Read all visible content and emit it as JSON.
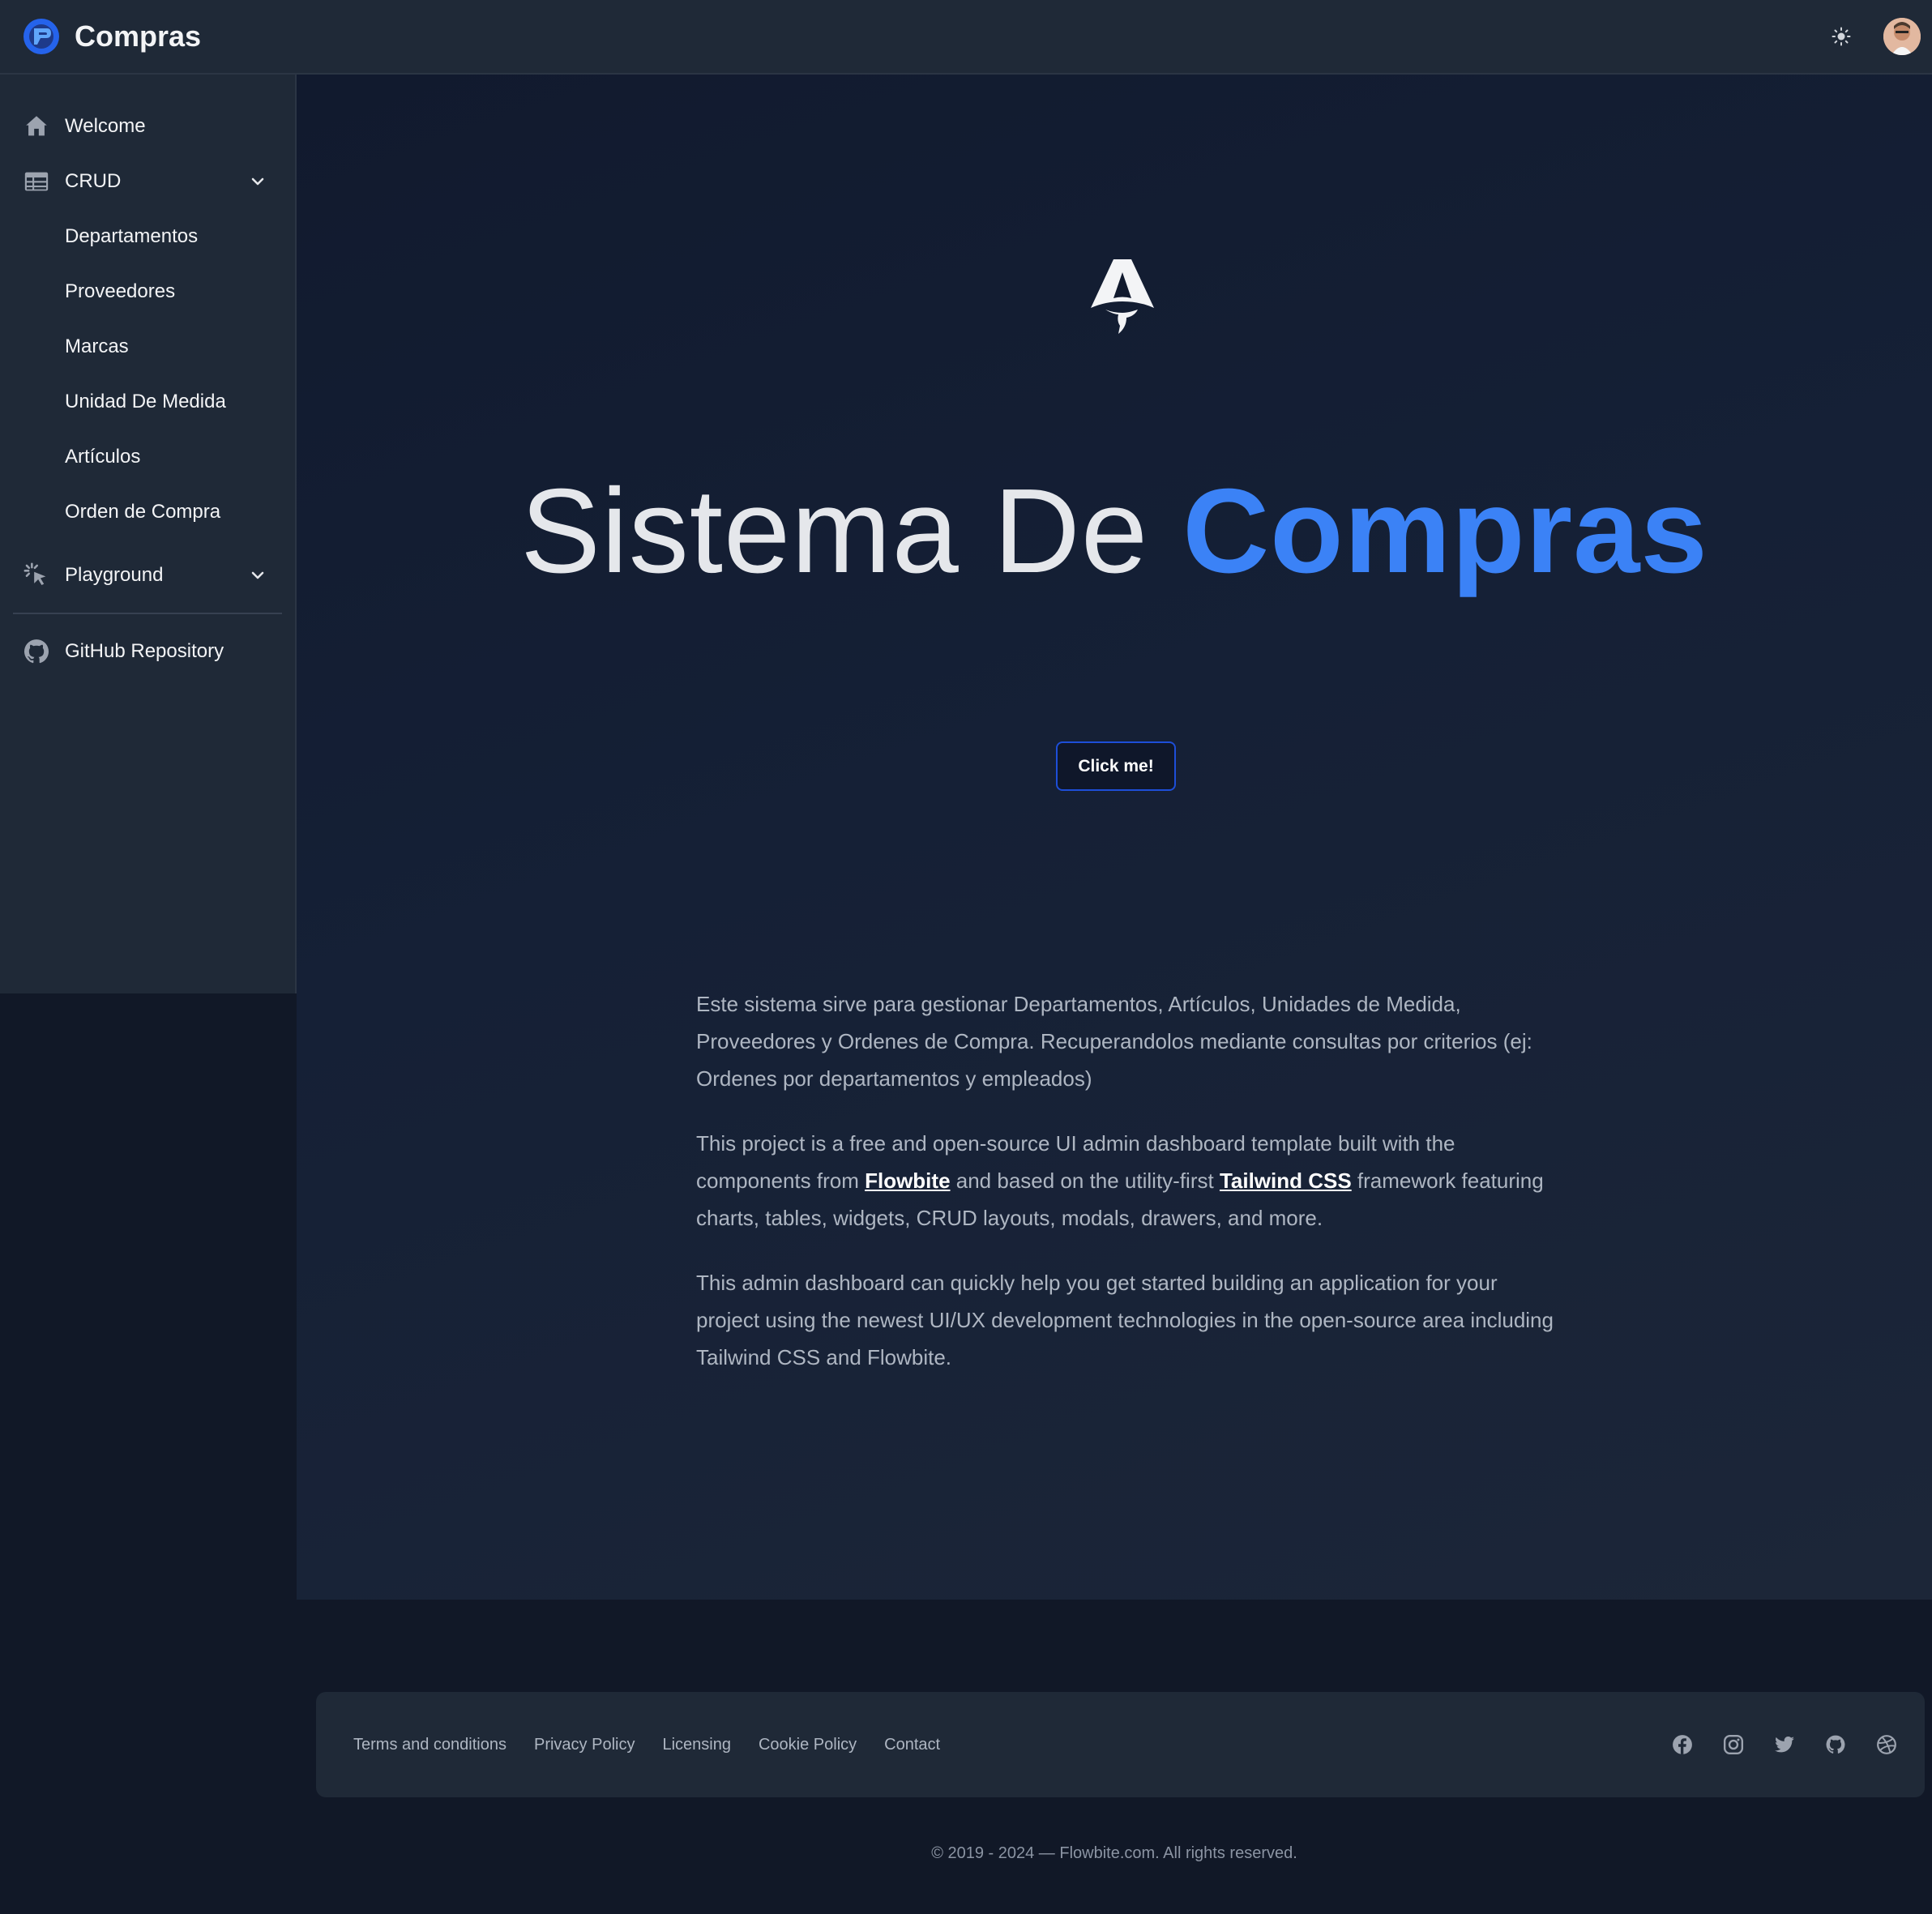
{
  "app": {
    "title": "Compras"
  },
  "sidebar": {
    "items": [
      {
        "label": "Welcome",
        "icon": "home-icon"
      },
      {
        "label": "CRUD",
        "icon": "table-icon"
      },
      {
        "label": "Playground",
        "icon": "cursor-click-icon"
      },
      {
        "label": "GitHub Repository",
        "icon": "github-icon"
      }
    ],
    "crud_subitems": [
      {
        "label": "Departamentos"
      },
      {
        "label": "Proveedores"
      },
      {
        "label": "Marcas"
      },
      {
        "label": "Unidad De Medida"
      },
      {
        "label": "Artículos"
      },
      {
        "label": "Orden de Compra"
      }
    ]
  },
  "hero": {
    "title_prefix": "Sistema De",
    "title_accent": "Compras",
    "button_label": "Click me!"
  },
  "content": {
    "p1": "Este sistema sirve para gestionar Departamentos, Artículos, Unidades de Medida, Proveedores y Ordenes de Compra. Recuperandolos mediante consultas por criterios (ej: Ordenes por departamentos y empleados)",
    "p2_start": "This project is a free and open-source UI admin dashboard template built with the components from ",
    "p2_link1": "Flowbite",
    "p2_mid": " and based on the utility-first ",
    "p2_link2": "Tailwind CSS",
    "p2_end": " framework featuring charts, tables, widgets, CRUD layouts, modals, drawers, and more.",
    "p3": "This admin dashboard can quickly help you get started building an application for your project using the newest UI/UX development technologies in the open-source area including Tailwind CSS and Flowbite."
  },
  "footer": {
    "links": [
      "Terms and conditions",
      "Privacy Policy",
      "Licensing",
      "Cookie Policy",
      "Contact"
    ],
    "socials": [
      "facebook-icon",
      "instagram-icon",
      "twitter-icon",
      "github-icon",
      "dribbble-icon"
    ],
    "copyright": "© 2019 - 2024 — Flowbite.com. All rights reserved."
  },
  "colors": {
    "accent": "#3b82f6",
    "background": "#111827",
    "panel": "#1f2937"
  }
}
